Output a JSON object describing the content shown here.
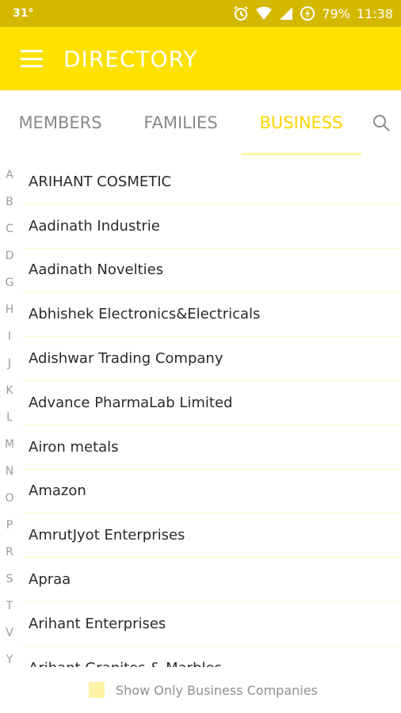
{
  "status_bar": {
    "temperature": "31°",
    "battery": "79%",
    "time": "11:38"
  },
  "app_bar": {
    "title": "DIRECTORY"
  },
  "tabs": [
    {
      "label": "MEMBERS",
      "active": false
    },
    {
      "label": "FAMILIES",
      "active": false
    },
    {
      "label": "BUSINESS",
      "active": true
    }
  ],
  "alpha_index": [
    "A",
    "B",
    "C",
    "D",
    "G",
    "H",
    "I",
    "J",
    "K",
    "L",
    "M",
    "N",
    "O",
    "P",
    "R",
    "S",
    "T",
    "V",
    "Y"
  ],
  "businesses": [
    "ARIHANT COSMETIC",
    "Aadinath Industrie",
    "Aadinath Novelties",
    "Abhishek Electronics&Electricals",
    "Adishwar Trading Company",
    "Advance PharmaLab Limited",
    "Airon metals",
    "Amazon",
    "AmrutJyot Enterprises",
    "Apraa",
    "Arihant Enterprises",
    "Arihant Granites & Marbles"
  ],
  "footer": {
    "checkbox_label": "Show Only Business Companies"
  },
  "colors": {
    "status_bar": "#d4b800",
    "accent": "#ffe100",
    "active_tab": "#ffd500"
  }
}
